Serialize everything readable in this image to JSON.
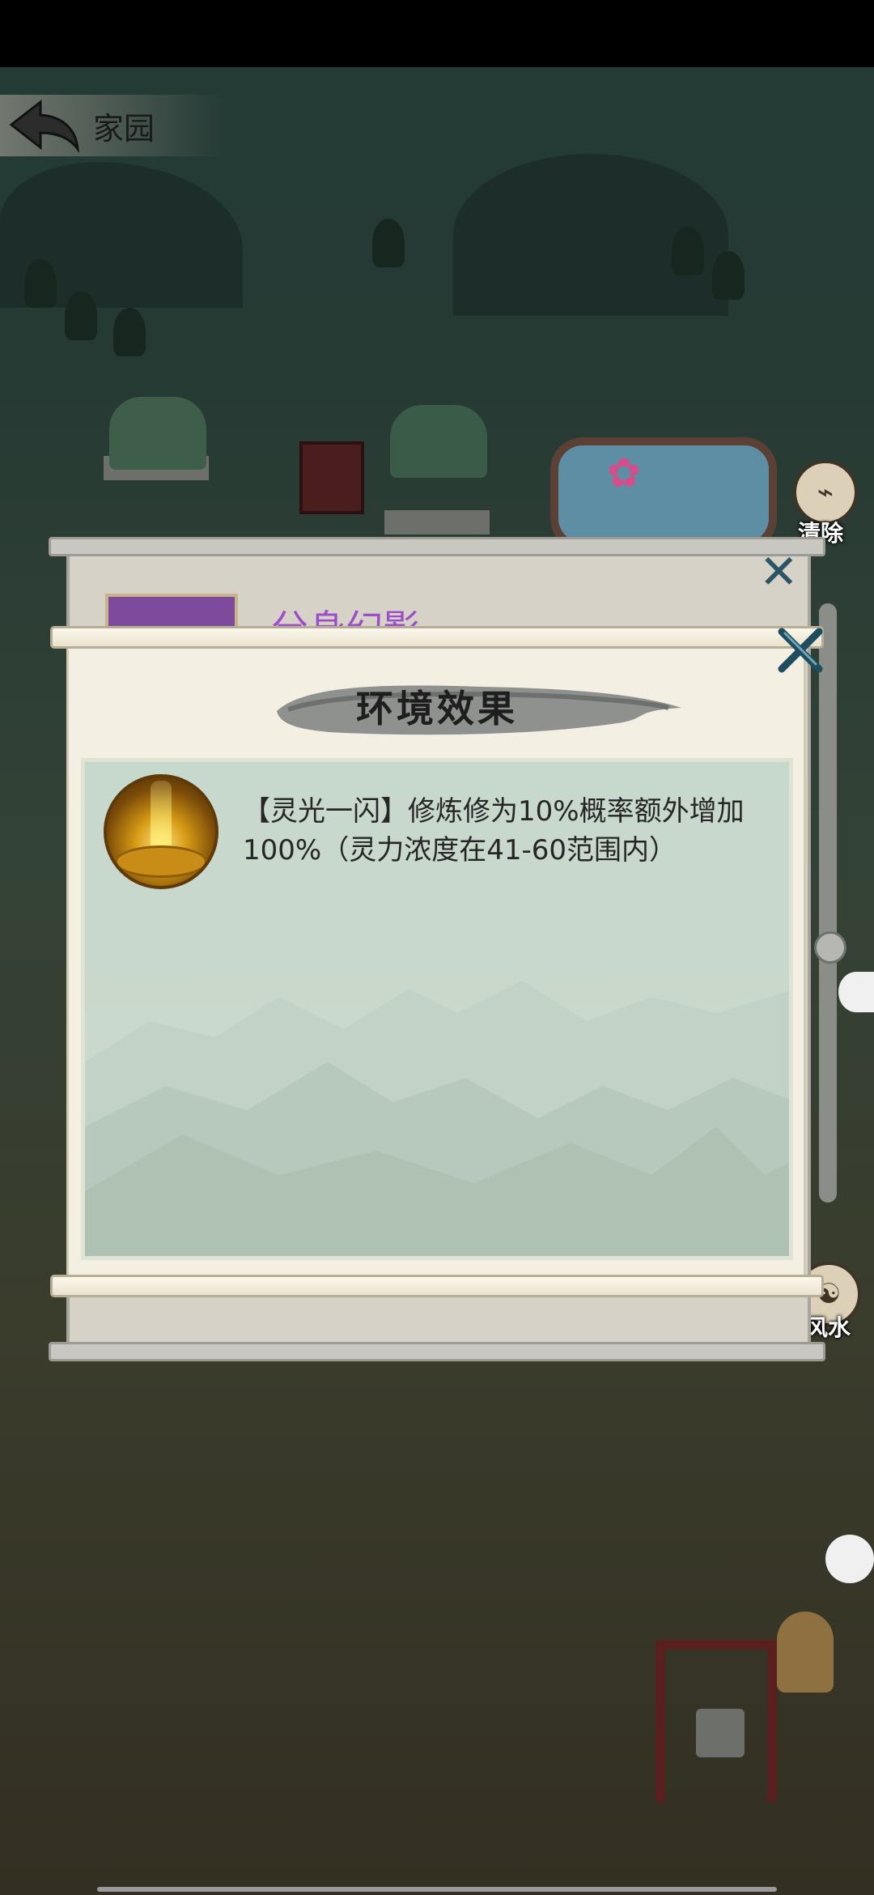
{
  "header": {
    "back_icon": "back-arrow-icon",
    "title": "家园"
  },
  "side_tools": {
    "clear_label": "清除",
    "clear_icon": "broom-icon",
    "fengshui_label": "风水",
    "fengshui_icon": "compass-icon"
  },
  "background_dialog": {
    "title": "分身幻影",
    "close_icon": "close-x-icon"
  },
  "dialog": {
    "title": "环境效果",
    "close_icon": "close-x-icon",
    "effects": [
      {
        "icon": "golden-light-pillar-icon",
        "text": "【灵光一闪】修炼修为10%概率额外增加100%（灵力浓度在41-60范围内）"
      }
    ]
  },
  "colors": {
    "accent_title_purple": "#9c4fc8",
    "close_x": "#2b5566",
    "panel_bg": "#c7d8cc",
    "paper": "#f3efe2"
  }
}
